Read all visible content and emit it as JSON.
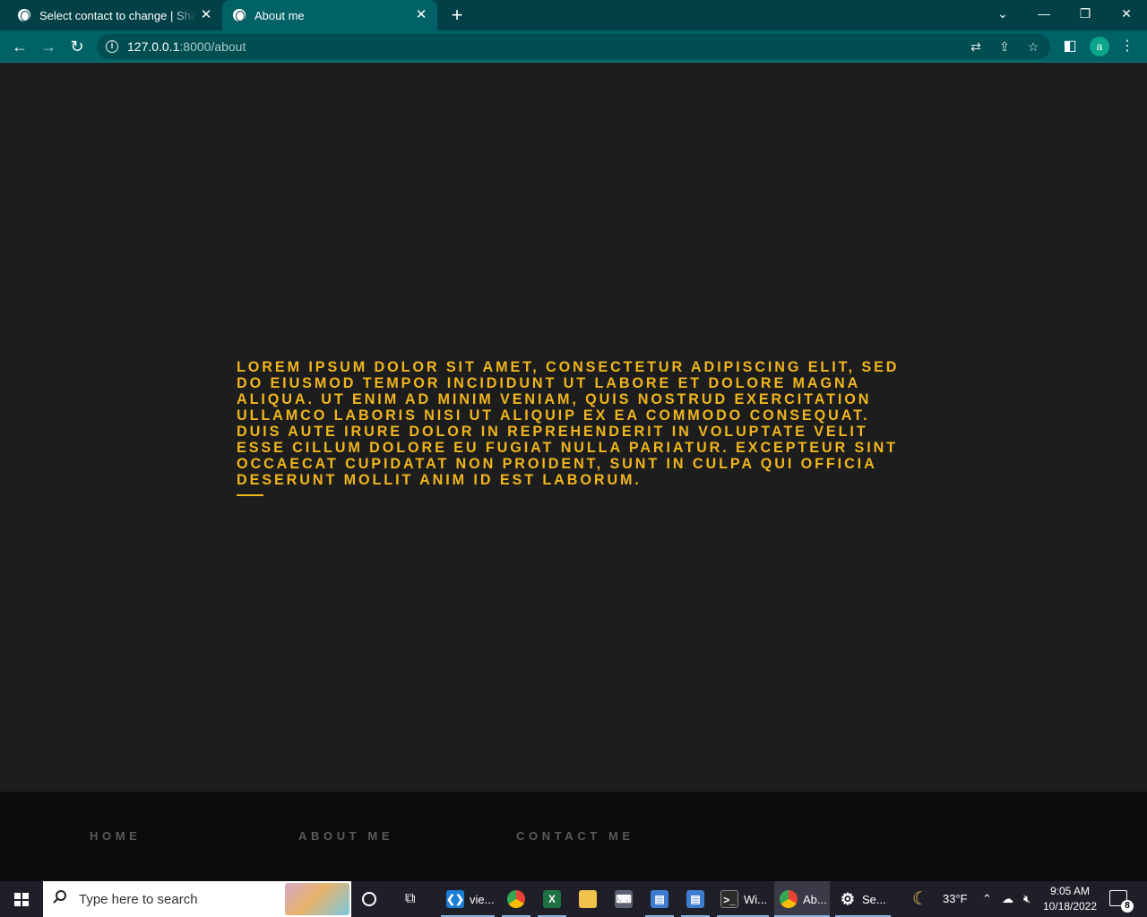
{
  "browser": {
    "tabs": [
      {
        "title": "Select contact to change | Shahm",
        "active": false
      },
      {
        "title": "About me",
        "active": true
      }
    ],
    "new_tab": "+",
    "url_host": "127.0.0.1",
    "url_rest": ":8000/about",
    "profile_initial": "a",
    "colors": {
      "frame": "#004046",
      "toolbar": "#006266",
      "accent": "#f1b51c"
    }
  },
  "page": {
    "about_text": "Lorem ipsum dolor sit amet, consectetur adipiscing elit, sed do eiusmod tempor incididunt ut labore et dolore magna aliqua. Ut enim ad minim veniam, quis nostrud exercitation ullamco laboris nisi ut aliquip ex ea commodo consequat. Duis aute irure dolor in reprehenderit in voluptate velit esse cillum dolore eu fugiat nulla pariatur. Excepteur sint occaecat cupidatat non proident, sunt in culpa qui officia deserunt mollit anim id est laborum."
  },
  "footer": {
    "links": [
      "HOME",
      "ABOUT ME",
      "CONTACT ME"
    ]
  },
  "taskbar": {
    "search_placeholder": "Type here to search",
    "apps": [
      {
        "label": "vie...",
        "icon": "vscode-icon"
      },
      {
        "label": "",
        "icon": "chrome-icon"
      },
      {
        "label": "",
        "icon": "excel-icon"
      },
      {
        "label": "",
        "icon": "file-explorer-icon"
      },
      {
        "label": "",
        "icon": "keyboard-app-icon"
      },
      {
        "label": "",
        "icon": "window-app-icon"
      },
      {
        "label": "",
        "icon": "window-app-icon"
      },
      {
        "label": "Wi...",
        "icon": "terminal-icon"
      },
      {
        "label": "Ab...",
        "icon": "chrome-icon"
      },
      {
        "label": "Se...",
        "icon": "settings-gear-icon"
      }
    ],
    "weather": "33°F",
    "time": "9:05 AM",
    "date": "10/18/2022",
    "notification_count": "8"
  }
}
